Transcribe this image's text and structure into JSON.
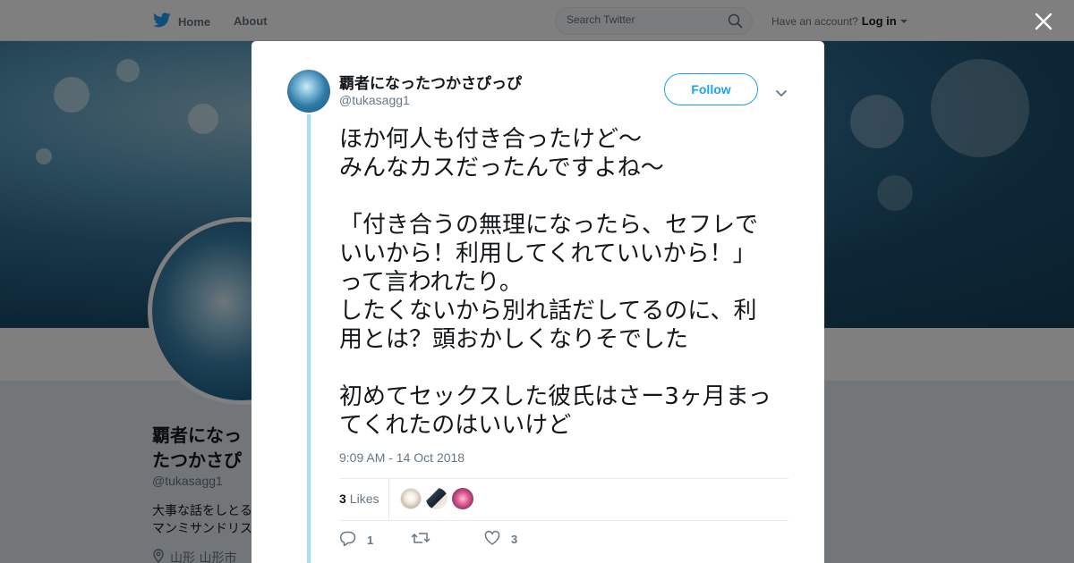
{
  "nav": {
    "home_label": "Home",
    "about_label": "About",
    "search_placeholder": "Search Twitter",
    "account_prompt": "Have an account?",
    "login_label": "Log in"
  },
  "profile": {
    "name": "覇者になったつかさぴっぴ",
    "handle": "@tukasagg1",
    "bio": "大事な話をしとるマンミサンドリス",
    "location": "山形 山形市"
  },
  "tweet": {
    "author_name": "覇者になったつかさぴっぴ",
    "author_handle": "@tukasagg1",
    "follow_label": "Follow",
    "text": "ほか何人も付き合ったけど～\nみんなカスだったんですよね～\n\n「付き合うの無理になったら、セフレでいいから！利用してくれていいから！」って言われたり。\nしたくないから別れ話だしてるのに、利用とは？頭おかしくなりそでした\n\n初めてセックスした彼氏はさー3ヶ月まってくれたのはいいけど",
    "timestamp": "9:09 AM - 14 Oct 2018",
    "likes_count": "3",
    "likes_label": "Likes",
    "reply_count": "1",
    "retweet_count": "",
    "like_count": "3"
  },
  "colors": {
    "accent": "#1da1f2",
    "thread_line": "#a7dff7",
    "text": "#14171a",
    "secondary": "#657786"
  },
  "icons": [
    "twitter-bird-icon",
    "search-icon",
    "close-icon",
    "chevron-down-icon",
    "reply-icon",
    "retweet-icon",
    "heart-icon",
    "location-pin-icon"
  ]
}
